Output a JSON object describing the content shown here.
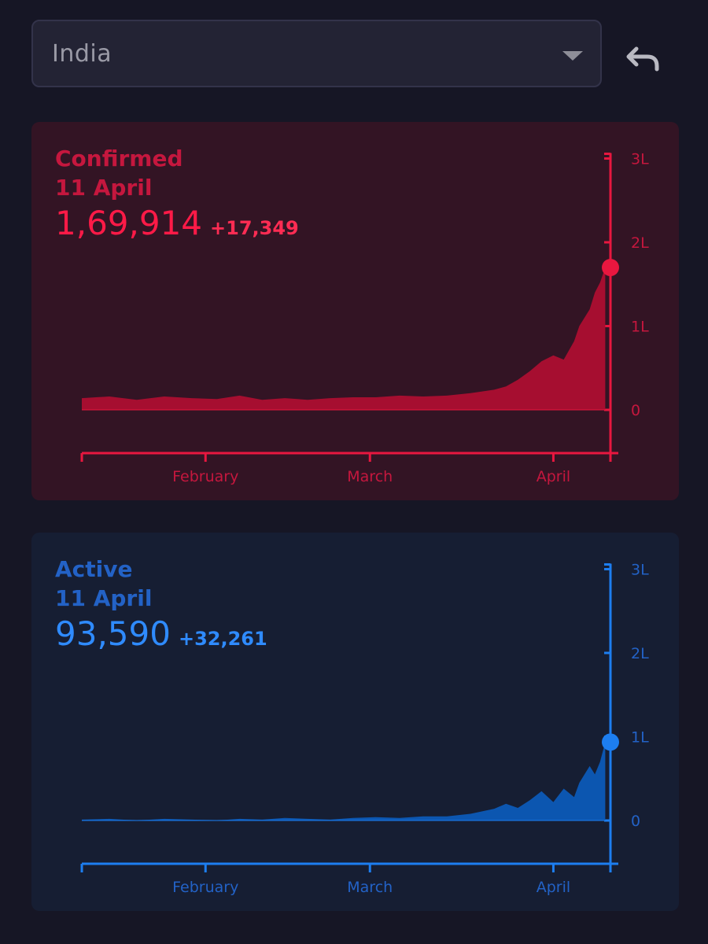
{
  "header": {
    "country_select": {
      "value": "India"
    },
    "back_icon": "reply-arrow-icon"
  },
  "cards": [
    {
      "key": "confirmed",
      "title": "Confirmed",
      "date": "11 April",
      "value": "1,69,914",
      "delta": "+17,349"
    },
    {
      "key": "active",
      "title": "Active",
      "date": "11 April",
      "value": "93,590",
      "delta": "+32,261"
    }
  ],
  "colors": {
    "background": "#161625",
    "confirmed_stroke": "#e8173f",
    "confirmed_fill": "#a60e30",
    "confirmed_label": "#c5173e",
    "active_stroke": "#1d7ef0",
    "active_fill": "#0c56b0",
    "active_label": "#2362c6"
  },
  "chart_data": [
    {
      "type": "area",
      "series": [
        {
          "name": "Confirmed",
          "x": [
            "14 Jan",
            "18 Jan",
            "22 Jan",
            "26 Jan",
            "30 Jan",
            "3 Feb",
            "7 Feb",
            "11 Feb",
            "15 Feb",
            "19 Feb",
            "23 Feb",
            "27 Feb",
            "2 Mar",
            "6 Mar",
            "10 Mar",
            "14 Mar",
            "18 Mar",
            "22 Mar",
            "24 Mar",
            "26 Mar",
            "28 Mar",
            "30 Mar",
            "1 Apr",
            "3 Apr",
            "5 Apr",
            "6 Apr",
            "8 Apr",
            "9 Apr",
            "10 Apr",
            "11 Apr"
          ],
          "values": [
            14000,
            16000,
            12000,
            16000,
            14000,
            13000,
            17000,
            12000,
            14000,
            12000,
            14000,
            15000,
            15000,
            17000,
            16000,
            17000,
            20000,
            24000,
            28000,
            36000,
            46000,
            58000,
            65000,
            60000,
            82000,
            100000,
            120000,
            140000,
            152000,
            169914
          ]
        }
      ],
      "x_ticks": [
        "February",
        "March",
        "April"
      ],
      "y_ticks": [
        "0",
        "1L",
        "2L",
        "3L"
      ],
      "ylim": [
        -50000,
        300000
      ],
      "highlight": {
        "x": "11 April",
        "value": 169914
      }
    },
    {
      "type": "area",
      "series": [
        {
          "name": "Active",
          "x": [
            "14 Jan",
            "18 Jan",
            "22 Jan",
            "26 Jan",
            "30 Jan",
            "3 Feb",
            "7 Feb",
            "11 Feb",
            "15 Feb",
            "19 Feb",
            "23 Feb",
            "27 Feb",
            "2 Mar",
            "6 Mar",
            "10 Mar",
            "14 Mar",
            "18 Mar",
            "22 Mar",
            "24 Mar",
            "26 Mar",
            "28 Mar",
            "30 Mar",
            "1 Apr",
            "3 Apr",
            "5 Apr",
            "6 Apr",
            "8 Apr",
            "9 Apr",
            "10 Apr",
            "11 Apr"
          ],
          "values": [
            1000,
            2000,
            0,
            2000,
            1000,
            0,
            2000,
            1000,
            3000,
            2000,
            1000,
            3000,
            4000,
            3000,
            5000,
            5000,
            8000,
            14000,
            20000,
            15000,
            24000,
            35000,
            22000,
            38000,
            28000,
            45000,
            65000,
            55000,
            70000,
            93590
          ]
        }
      ],
      "x_ticks": [
        "February",
        "March",
        "April"
      ],
      "y_ticks": [
        "0",
        "1L",
        "2L",
        "3L"
      ],
      "ylim": [
        -50000,
        300000
      ],
      "highlight": {
        "x": "11 April",
        "value": 93590
      }
    }
  ]
}
